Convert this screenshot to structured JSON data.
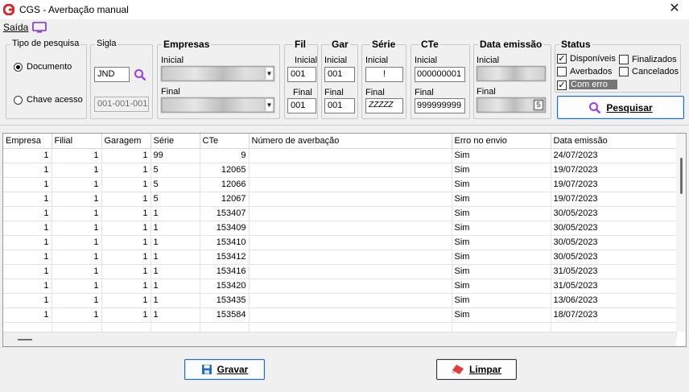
{
  "window": {
    "title": "CGS -  Averbação manual"
  },
  "menu": {
    "saida": "Saída"
  },
  "tipo_pesquisa": {
    "label": "Tipo de pesquisa",
    "options": [
      {
        "label": "Documento",
        "selected": true
      },
      {
        "label": "Chave acesso",
        "selected": false
      }
    ]
  },
  "sigla": {
    "label": "Sigla",
    "value": "JND",
    "chave_value": "001-001-001"
  },
  "empresas": {
    "label": "Empresas",
    "inicial_label": "Inicial",
    "final_label": "Final"
  },
  "fil": {
    "label": "Fil",
    "inicial_label": "Inicial",
    "inicial": "001",
    "final_label": "Final",
    "final": "001"
  },
  "gar": {
    "label": "Gar",
    "inicial_label": "Inicial",
    "inicial": "001",
    "final_label": "Final",
    "final": "001"
  },
  "serie": {
    "label": "Série",
    "inicial_label": "Inicial",
    "inicial": "!",
    "final_label": "Final",
    "final": "ZZZZZ"
  },
  "cte": {
    "label": "CTe",
    "inicial_label": "Inicial",
    "inicial": "000000001",
    "final_label": "Final",
    "final": "999999999"
  },
  "data_emissao": {
    "label": "Data emissão",
    "inicial_label": "Inicial",
    "final_label": "Final",
    "cal_icon": "5"
  },
  "status": {
    "label": "Status",
    "items": [
      {
        "label": "Disponíveis",
        "checked": true
      },
      {
        "label": "Finalizados",
        "checked": false
      },
      {
        "label": "Averbados",
        "checked": false
      },
      {
        "label": "Cancelados",
        "checked": false
      },
      {
        "label": "Com erro",
        "checked": true
      }
    ]
  },
  "buttons": {
    "pesquisar": "Pesquisar",
    "gravar": "Gravar",
    "limpar": "Limpar"
  },
  "table": {
    "columns": [
      "Empresa",
      "Filial",
      "Garagem",
      "Série",
      "CTe",
      "Número de averbação",
      "Erro no envio",
      "Data emissão"
    ],
    "rows": [
      [
        "1",
        "1",
        "1",
        "99",
        "9",
        "",
        "Sim",
        "24/07/2023"
      ],
      [
        "1",
        "1",
        "1",
        "5",
        "12065",
        "",
        "Sim",
        "19/07/2023"
      ],
      [
        "1",
        "1",
        "1",
        "5",
        "12066",
        "",
        "Sim",
        "19/07/2023"
      ],
      [
        "1",
        "1",
        "1",
        "5",
        "12067",
        "",
        "Sim",
        "19/07/2023"
      ],
      [
        "1",
        "1",
        "1",
        "1",
        "153407",
        "",
        "Sim",
        "30/05/2023"
      ],
      [
        "1",
        "1",
        "1",
        "1",
        "153409",
        "",
        "Sim",
        "30/05/2023"
      ],
      [
        "1",
        "1",
        "1",
        "1",
        "153410",
        "",
        "Sim",
        "30/05/2023"
      ],
      [
        "1",
        "1",
        "1",
        "1",
        "153412",
        "",
        "Sim",
        "30/05/2023"
      ],
      [
        "1",
        "1",
        "1",
        "1",
        "153416",
        "",
        "Sim",
        "31/05/2023"
      ],
      [
        "1",
        "1",
        "1",
        "1",
        "153420",
        "",
        "Sim",
        "31/05/2023"
      ],
      [
        "1",
        "1",
        "1",
        "1",
        "153435",
        "",
        "Sim",
        "13/06/2023"
      ],
      [
        "1",
        "1",
        "1",
        "1",
        "153584",
        "",
        "Sim",
        "18/07/2023"
      ]
    ]
  },
  "colors": {
    "accent": "#1c6ad1",
    "logo": "#d42a2a",
    "monitor_icon": "#7b2fd1",
    "search_icon": "#9b3fe0"
  }
}
